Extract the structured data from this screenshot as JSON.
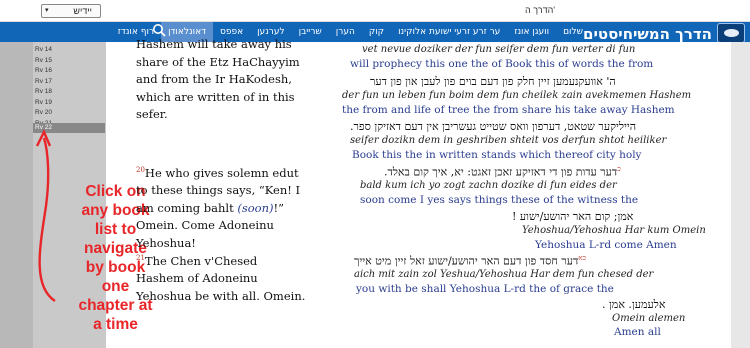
{
  "header": {
    "language_select": "יידיש",
    "edition_label": "הדרך ה'",
    "brand": "הדרך המשיחיסטים"
  },
  "nav": {
    "items": [
      "שלום",
      "וועגן אונז",
      "ער זרע זרעי ישועת אלוקינו",
      "קוק",
      "הערן",
      "שרייבן",
      "לערנען",
      "אפפס",
      "דאונלאודן",
      "רוף אונדז"
    ],
    "active_index": 8
  },
  "sidebar": {
    "items": [
      "Rv 14",
      "Rv 15",
      "Rv 16",
      "Rv 17",
      "Rv 18",
      "Rv 19",
      "Rv 20",
      "Rv 21",
      "Rv 22"
    ],
    "selected": "Rv 22"
  },
  "annotation": {
    "lines": [
      "Click on",
      "any book",
      "list to",
      "navigate",
      "by book",
      "one",
      "chapter at",
      "a time"
    ],
    "color": "#e8262a"
  },
  "english": {
    "para1": "Hashem will take away his share of the Etz HaChayyim and from the Ir HaKodesh, which are written of in this sefer.",
    "verse20_num": "20",
    "verse20_text": "He who gives solemn edut to these things says, “Ken! I am coming bahlt ",
    "verse20_italic": "(soon)",
    "verse20_end": "!” Omein. Come Adoneinu Yehoshua!",
    "verse21_num": "21",
    "verse21_text": "The Chen v'Chesed Hashem of Adoneinu Yehoshua be with all. Omein."
  },
  "yiddish": {
    "l1_translit": "vet nevue doziker der fun seifer dem fun verter di fun",
    "l1_gloss": "will prophecy this one the of Book this of words the from",
    "l2_orth": "ה' אוועקנעמען זיין חלק פון דעם בוים פון לעבן און פון דער",
    "l2_translit": "der fun un leben fun boim dem fun cheilek zain avekmemen Hashem",
    "l2_gloss": "the from and life of tree the from share his take away Hashem",
    "l3_orth": "הייליקער שטאט, דערפון וואס שטייט געשריבן אין דעם דאזיקן ספר.",
    "l3_translit": "seifer dozikn dem in geshriben shteit vos derfun shtot heiliker",
    "l3_gloss": "Book this the in written stands which thereof city holy",
    "v20_num": "כ",
    "l4_orth": "דער עדות פון די דאזיקע זאכן זאגט: יא, איך קום באלד.",
    "l4_translit": "bald kum ich yo zogt zachn dozike di fun eides der",
    "l4_gloss": "soon come I yes says things these of the witness the",
    "l5_orth": "אמן; קום האר יהושע/ישוע !",
    "l5_translit": "Yehoshua/Yehoshua Har kum Omein",
    "l5_gloss": "Yehoshua L-rd come Amen",
    "v21_num": "כא",
    "l6_orth": "דער חסד פון דעם האר יהושע/ישוע זאל זיין מיט אייך",
    "l6_translit": "aich mit zain zol Yeshua/Yehoshua Har dem fun chesed der",
    "l6_gloss": "you with be shall Yehoshua L-rd the of grace the",
    "l7_orth": "אלעמען. אמן .",
    "l7_translit": "Omein alemen",
    "l7_gloss": "Amen all"
  }
}
